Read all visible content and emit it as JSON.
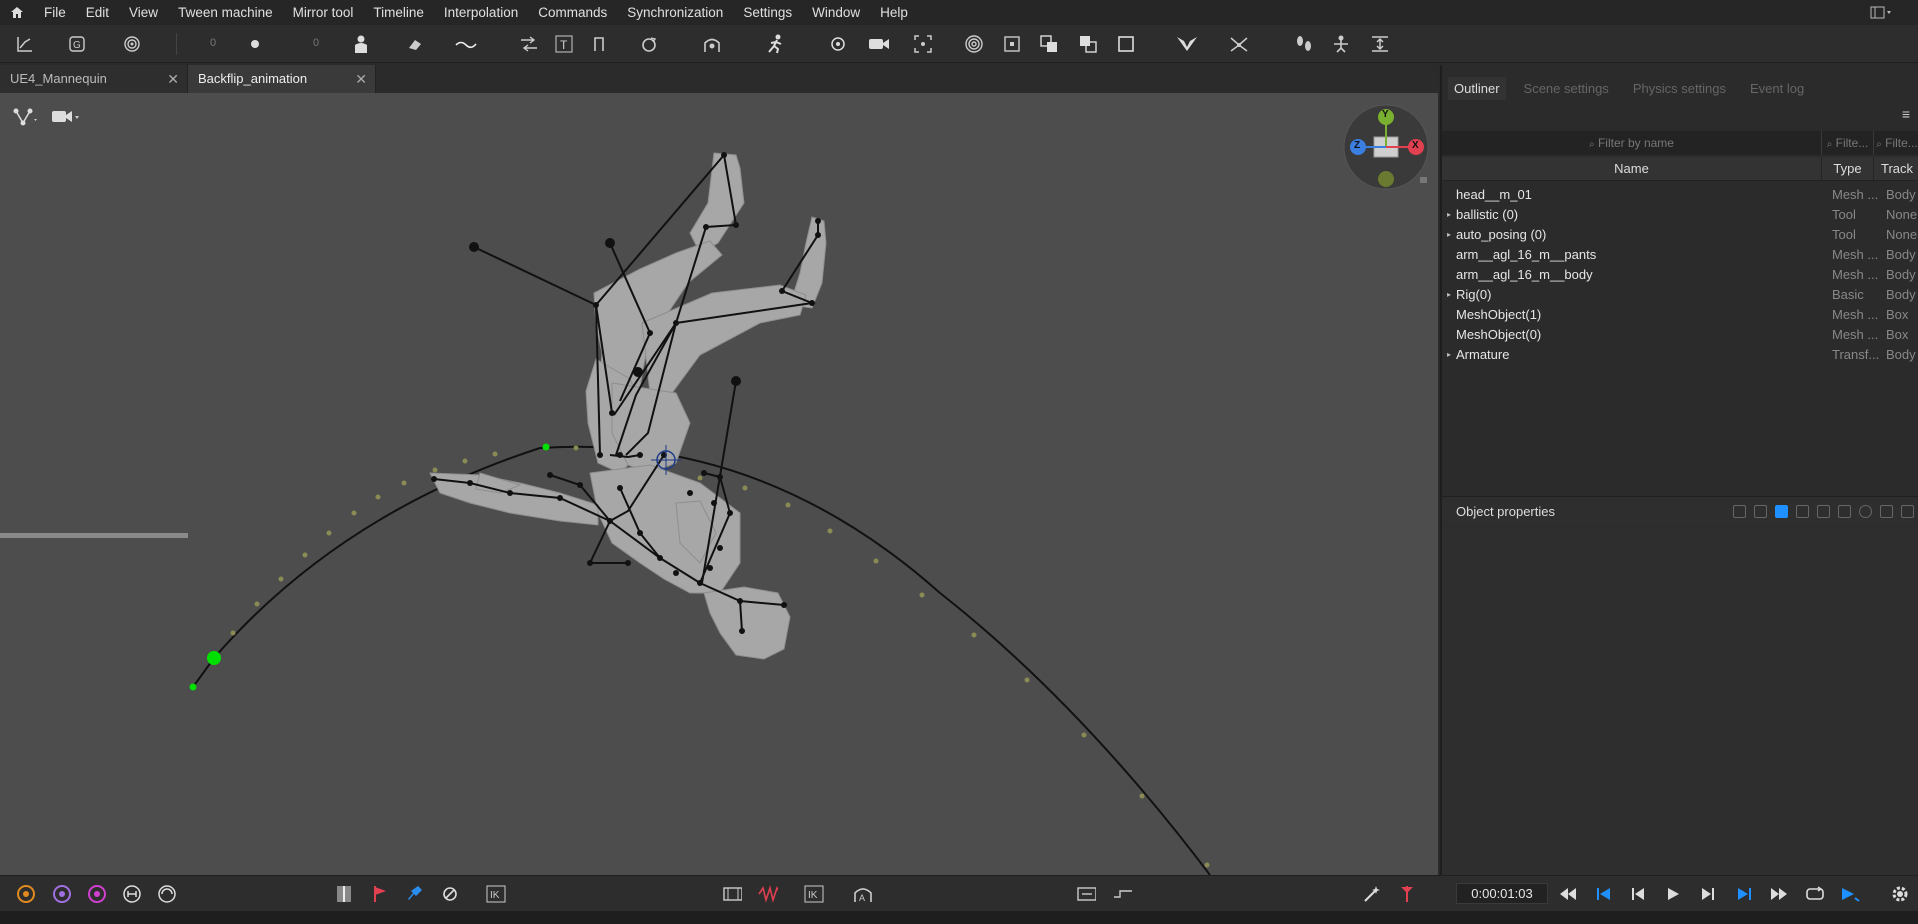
{
  "menu": [
    "File",
    "Edit",
    "View",
    "Tween machine",
    "Mirror tool",
    "Timeline",
    "Interpolation",
    "Commands",
    "Synchronization",
    "Settings",
    "Window",
    "Help"
  ],
  "toolbar": {
    "num1": "0",
    "num2": "0"
  },
  "tabs": [
    {
      "label": "UE4_Mannequin",
      "close": "✕"
    },
    {
      "label": "Backflip_animation",
      "close": "✕"
    }
  ],
  "gizmo": {
    "y": "Y",
    "z": "Z",
    "x": "X"
  },
  "outliner": {
    "tabs": [
      "Outliner",
      "Scene settings",
      "Physics settings",
      "Event log"
    ],
    "filter_placeholder": "Filter by name",
    "filter_type": "Filte...",
    "filter_track": "Filte...",
    "columns": {
      "name": "Name",
      "type": "Type",
      "track": "Track"
    },
    "rows": [
      {
        "arrow": "",
        "name": "head__m_01",
        "type": "Mesh ...",
        "track": "Body"
      },
      {
        "arrow": "▸",
        "name": "ballistic (0)",
        "type": "Tool",
        "track": "None"
      },
      {
        "arrow": "▸",
        "name": "auto_posing (0)",
        "type": "Tool",
        "track": "None"
      },
      {
        "arrow": "",
        "name": "arm__agl_16_m__pants",
        "type": "Mesh ...",
        "track": "Body"
      },
      {
        "arrow": "",
        "name": "arm__agl_16_m__body",
        "type": "Mesh ...",
        "track": "Body"
      },
      {
        "arrow": "▸",
        "name": "Rig(0)",
        "type": "Basic",
        "track": "Body"
      },
      {
        "arrow": "",
        "name": "MeshObject(1)",
        "type": "Mesh ...",
        "track": "Box"
      },
      {
        "arrow": "",
        "name": "MeshObject(0)",
        "type": "Mesh ...",
        "track": "Box"
      },
      {
        "arrow": "▸",
        "name": "Armature",
        "type": "Transf...",
        "track": "Body"
      }
    ]
  },
  "properties": {
    "title": "Object properties"
  },
  "timeline": {
    "time": "0:00:01:03"
  },
  "colors": {
    "accent": "#1e90ff",
    "trajectory_key": "#00e000",
    "gizmo_x": "#e04050",
    "gizmo_y": "#7ab030",
    "gizmo_z": "#3a7ee0"
  }
}
